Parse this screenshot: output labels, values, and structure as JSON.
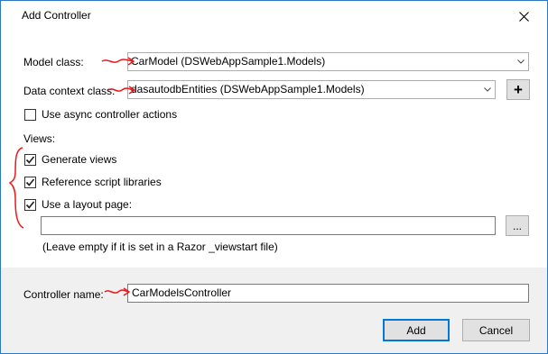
{
  "window": {
    "title": "Add Controller"
  },
  "form": {
    "model_class": {
      "label": "Model class:",
      "value": "CarModel (DSWebAppSample1.Models)"
    },
    "data_context": {
      "label": "Data context class:",
      "value": "dasautodbEntities (DSWebAppSample1.Models)",
      "add_button": "+"
    },
    "async": {
      "label": "Use async controller actions",
      "checked": false
    },
    "views": {
      "label": "Views:",
      "generate": {
        "label": "Generate views",
        "checked": true
      },
      "reference_scripts": {
        "label": "Reference script libraries",
        "checked": true
      },
      "layout_page": {
        "label": "Use a layout page:",
        "checked": true,
        "value": "",
        "browse": "..."
      },
      "hint": "(Leave empty if it is set in a Razor _viewstart file)"
    },
    "controller_name": {
      "label": "Controller name:",
      "value": "CarModelsController"
    }
  },
  "buttons": {
    "add": "Add",
    "cancel": "Cancel"
  },
  "colors": {
    "accent": "#0078d7",
    "annotation": "#e8191d",
    "footer": "#f0f0f0",
    "border": "#2b78c5"
  },
  "icons": [
    "close-icon",
    "chevron-down-icon",
    "check-icon"
  ]
}
